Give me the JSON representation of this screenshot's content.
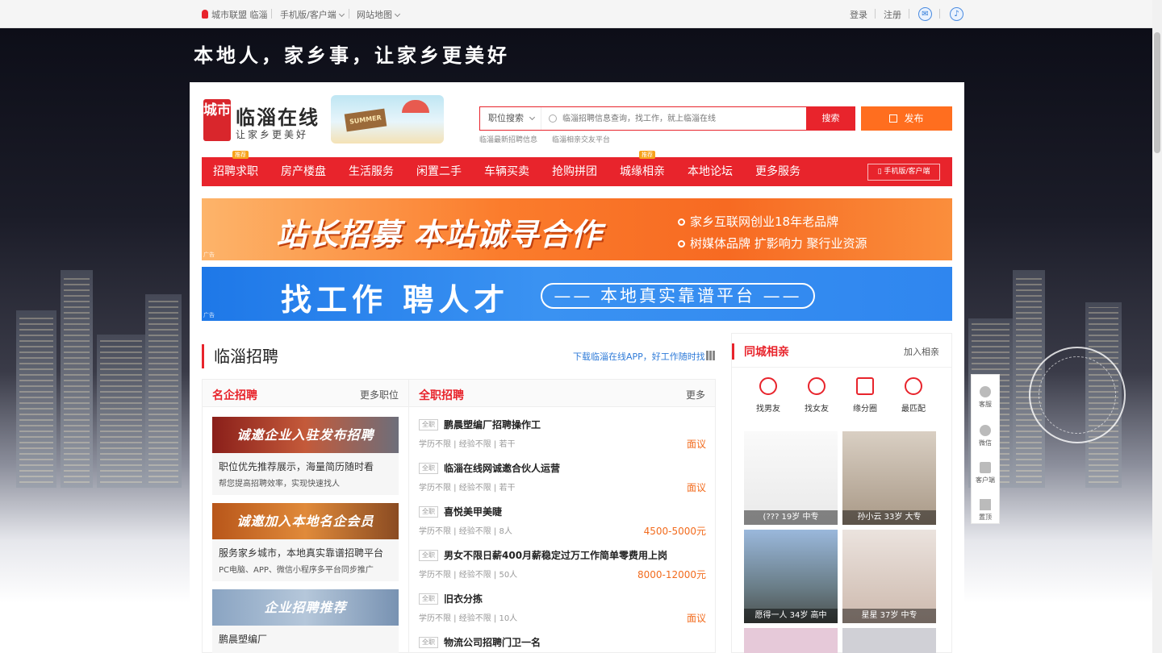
{
  "topbar": {
    "location": "城市联盟 临淄",
    "mobile": "手机版/客户端",
    "sitemap": "网站地图",
    "login": "登录",
    "register": "注册"
  },
  "slogan": "本地人，家乡事，让家乡更美好",
  "logo": {
    "seal": "城市",
    "name": "临淄在线",
    "sub": "让家乡更美好",
    "decor_text": "SUMMER"
  },
  "search": {
    "category": "职位搜索",
    "placeholder": "临淄招聘信息查询，找工作，就上临淄在线",
    "button": "搜索",
    "publish": "发布",
    "hot_links": [
      "临淄最新招聘信息",
      "临淄相亲交友平台"
    ]
  },
  "nav": {
    "items": [
      "招聘求职",
      "房产楼盘",
      "生活服务",
      "闲置二手",
      "车辆买卖",
      "抢购拼团",
      "城缘相亲",
      "本地论坛",
      "更多服务"
    ],
    "badge": "推荐",
    "mobile": "手机版/客户端"
  },
  "banner1": {
    "title": "站长招募 本站诚寻合作",
    "point1": "家乡互联网创业18年老品牌",
    "point2": "树媒体品牌 扩影响力 聚行业资源",
    "ad": "广告"
  },
  "banner2": {
    "title": "找工作 聘人才",
    "pill": "—— 本地真实靠谱平台 ——",
    "ad": "广告"
  },
  "recruit": {
    "title": "临淄招聘",
    "download": "下载临淄在线APP，好工作随时找",
    "corp_col": {
      "title": "名企招聘",
      "more": "更多职位",
      "cards": [
        {
          "img": "诚邀企业入驻发布招聘",
          "line1": "职位优先推荐展示，海量简历随时看",
          "line2": "帮您提高招聘效率，实现快速找人"
        },
        {
          "img": "诚邀加入本地名企会员",
          "line1": "服务家乡城市，本地真实靠谱招聘平台",
          "line2": "PC电脑、APP、微信小程序多平台同步推广"
        },
        {
          "img": "企业招聘推荐",
          "line1": "鹏晨塑编厂",
          "line2": ""
        }
      ]
    },
    "full_col": {
      "title": "全职招聘",
      "more": "更多",
      "tag": "全职",
      "jobs": [
        {
          "name": "鹏晨塑编厂招聘操作工",
          "req": "学历不限 | 经验不限 | 若干",
          "salary": "面议"
        },
        {
          "name": "临淄在线网诚邀合伙人运营",
          "req": "学历不限 | 经验不限 | 若干",
          "salary": "面议"
        },
        {
          "name": "喜悦美甲美睫",
          "req": "学历不限 | 经验不限 | 8人",
          "salary": "4500-5000元"
        },
        {
          "name": "男女不限日薪400月薪稳定过万工作简单零费用上岗",
          "req": "学历不限 | 经验不限 | 50人",
          "salary": "8000-12000元"
        },
        {
          "name": "旧衣分拣",
          "req": "学历不限 | 经验不限 | 10人",
          "salary": "面议"
        },
        {
          "name": "物流公司招聘门卫一名",
          "req": "",
          "salary": ""
        }
      ]
    }
  },
  "dating": {
    "title": "同城相亲",
    "join": "加入相亲",
    "quick": [
      "找男友",
      "找女友",
      "缘分圈",
      "最匹配"
    ],
    "profiles": [
      {
        "caption": "(??? 19岁 中专"
      },
      {
        "caption": "孙小云 33岁 大专"
      },
      {
        "caption": "愿得一人 34岁 高中"
      },
      {
        "caption": "星星 37岁 中专"
      }
    ]
  },
  "float_bar": [
    "客服",
    "微信",
    "客户端",
    "置顶"
  ]
}
